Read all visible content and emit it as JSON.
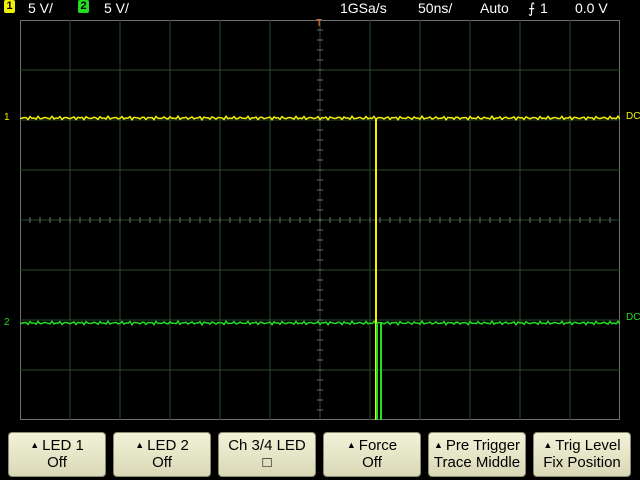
{
  "status": {
    "ch1": {
      "num": "1",
      "scale": "5 V/",
      "color": "#f0f000"
    },
    "ch2": {
      "num": "2",
      "scale": "5 V/",
      "color": "#22dd22"
    },
    "sample_rate": "1GSa/s",
    "timebase": "50ns/",
    "trigger_mode": "Auto",
    "trigger_source": "1",
    "trigger_level": "0.0 V"
  },
  "channels": {
    "ch1_marker": "1",
    "ch2_marker": "2",
    "ch1_coupling": "DC",
    "ch2_coupling": "DC",
    "trigger_marker": "T"
  },
  "softkeys": [
    {
      "line1": "LED 1",
      "line2": "Off",
      "arrow": true
    },
    {
      "line1": "LED 2",
      "line2": "Off",
      "arrow": true
    },
    {
      "line1": "Ch 3/4 LED",
      "line2": "□",
      "arrow": false
    },
    {
      "line1": "Force",
      "line2": "Off",
      "arrow": true
    },
    {
      "line1": "Pre Trigger",
      "line2": "Trace Middle",
      "arrow": true
    },
    {
      "line1": "Trig Level",
      "line2": "Fix Position",
      "arrow": true
    }
  ],
  "colors": {
    "grid": "#2a4a2a",
    "grid_border": "#707070",
    "ch1": "#f0f000",
    "ch2": "#22dd22",
    "trigger": "#ff8040"
  }
}
